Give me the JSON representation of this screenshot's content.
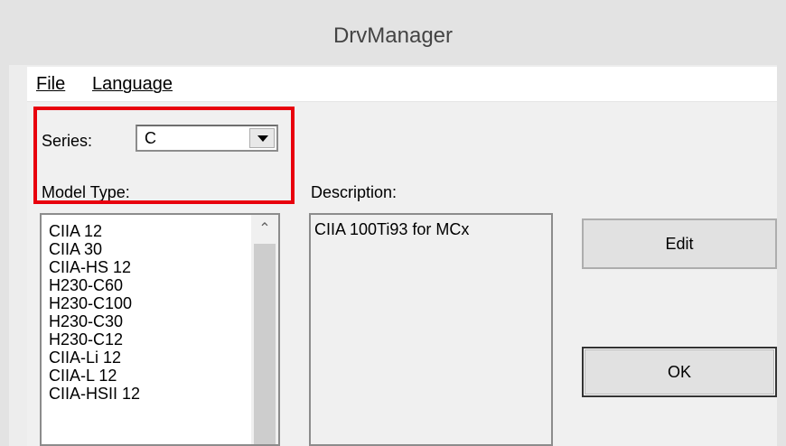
{
  "window": {
    "title": "DrvManager"
  },
  "menu": {
    "items": [
      "File",
      "Language"
    ]
  },
  "series": {
    "label": "Series:",
    "value": "C"
  },
  "model_type": {
    "label": "Model Type:",
    "items": [
      "CIIA 12",
      "CIIA 30",
      "CIIA-HS 12",
      "H230-C60",
      "H230-C100",
      "H230-C30",
      "H230-C12",
      "CIIA-Li 12",
      "CIIA-L 12",
      "CIIA-HSII 12"
    ]
  },
  "description": {
    "label": "Description:",
    "value": "CIIA 100Ti93 for MCx"
  },
  "buttons": {
    "edit": "Edit",
    "ok": "OK"
  },
  "colors": {
    "highlight": "#e8000d"
  }
}
